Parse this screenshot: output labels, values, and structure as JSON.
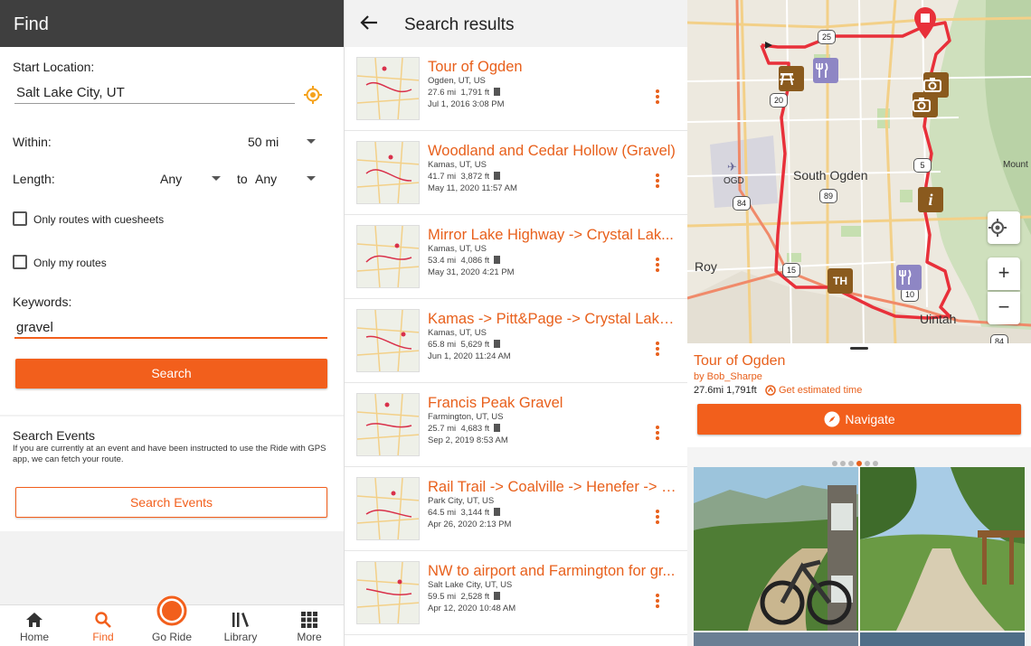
{
  "find": {
    "title": "Find",
    "start_location_label": "Start Location:",
    "start_location_value": "Salt Lake City, UT",
    "within_label": "Within:",
    "within_value": "50 mi",
    "length_label": "Length:",
    "length_min": "Any",
    "length_to": "to",
    "length_max": "Any",
    "cuesheets_label": "Only routes with cuesheets",
    "my_routes_label": "Only my routes",
    "keywords_label": "Keywords:",
    "keywords_value": "gravel",
    "search_button": "Search",
    "events_title": "Search Events",
    "events_desc": "If you are currently at an event and have been instructed to use the Ride with GPS app, we can fetch your route.",
    "events_button": "Search Events"
  },
  "nav": [
    {
      "label": "Home",
      "icon": "home-icon"
    },
    {
      "label": "Find",
      "icon": "search-icon"
    },
    {
      "label": "Go Ride",
      "icon": "record-icon"
    },
    {
      "label": "Library",
      "icon": "library-icon"
    },
    {
      "label": "More",
      "icon": "grid-icon"
    }
  ],
  "results": {
    "title": "Search results",
    "items": [
      {
        "title": "Tour of Ogden",
        "location": "Ogden, UT, US",
        "distance": "27.6 mi",
        "elevation": "1,791 ft",
        "date": "Jul 1, 2016 3:08 PM"
      },
      {
        "title": "Woodland and Cedar Hollow (Gravel)",
        "location": "Kamas, UT, US",
        "distance": "41.7 mi",
        "elevation": "3,872 ft",
        "date": "May 11, 2020 11:57 AM"
      },
      {
        "title": "Mirror Lake Highway -> Crystal Lak...",
        "location": "Kamas, UT, US",
        "distance": "53.4 mi",
        "elevation": "4,086 ft",
        "date": "May 31, 2020 4:21 PM"
      },
      {
        "title": "Kamas -> Pitt&Page -> Crystal Lake...",
        "location": "Kamas, UT, US",
        "distance": "65.8 mi",
        "elevation": "5,629 ft",
        "date": "Jun 1, 2020 11:24 AM"
      },
      {
        "title": "Francis Peak Gravel",
        "location": "Farmington, UT, US",
        "distance": "25.7 mi",
        "elevation": "4,683 ft",
        "date": "Sep 2, 2019 8:53 AM"
      },
      {
        "title": "Rail Trail -> Coalville -> Henefer -> J...",
        "location": "Park City, UT, US",
        "distance": "64.5 mi",
        "elevation": "3,144 ft",
        "date": "Apr 26, 2020 2:13 PM"
      },
      {
        "title": "NW to airport and Farmington for gr...",
        "location": "Salt Lake City, UT, US",
        "distance": "59.5 mi",
        "elevation": "2,528 ft",
        "date": "Apr 12, 2020 10:48 AM"
      }
    ]
  },
  "map": {
    "labels": {
      "south_ogden": "South Ogden",
      "roy": "Roy",
      "uintah": "Uintah",
      "ogd": "OGD",
      "mount": "Mount"
    },
    "shields": [
      "25",
      "20",
      "5",
      "89",
      "84",
      "15",
      "10",
      "84"
    ],
    "poi": {
      "th": "TH",
      "info": "i"
    },
    "zoom_in": "+",
    "zoom_out": "−"
  },
  "detail": {
    "title": "Tour of Ogden",
    "by": "by Bob_Sharpe",
    "stats": "27.6mi 1,791ft",
    "estimate": "Get estimated time",
    "navigate": "Navigate",
    "page_count": 6,
    "active_page": 4
  },
  "colors": {
    "accent": "#f25f1c",
    "route": "#e8303a",
    "appbar": "#3f3f3f"
  }
}
